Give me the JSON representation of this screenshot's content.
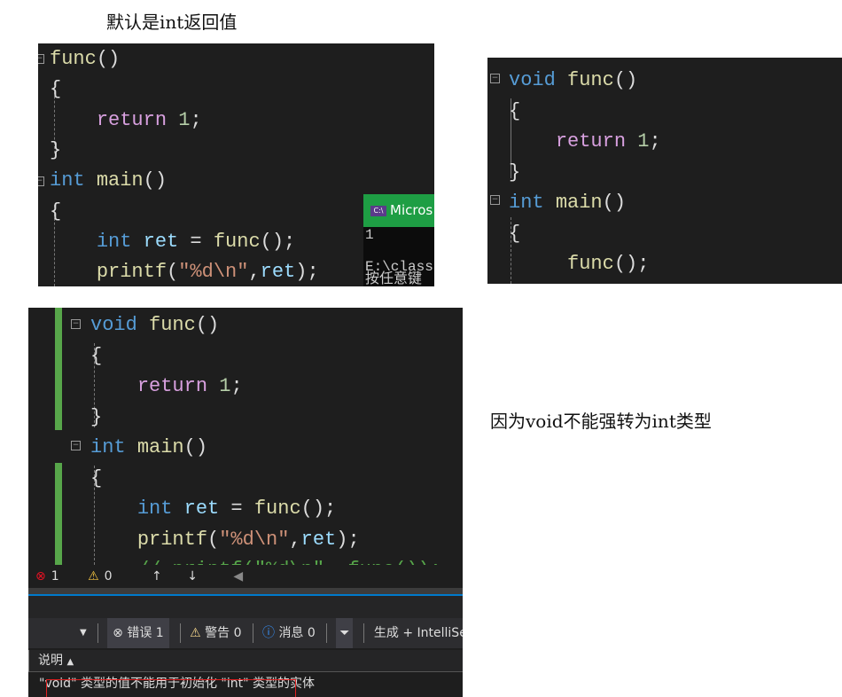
{
  "notes": {
    "top": "默认是int返回值",
    "right": "因为void不能强转为int类型"
  },
  "panel1": {
    "lines": [
      [
        [
          "func",
          "f"
        ],
        [
          "()",
          "p"
        ]
      ],
      [
        [
          "{",
          "p"
        ]
      ],
      [
        [
          "    ",
          "p"
        ],
        [
          "return",
          "c"
        ],
        [
          " ",
          "p"
        ],
        [
          "1",
          "n"
        ],
        [
          ";",
          "p"
        ]
      ],
      [
        [
          "}",
          "p"
        ]
      ],
      [
        [
          "int",
          "k"
        ],
        [
          " ",
          "p"
        ],
        [
          "main",
          "f"
        ],
        [
          "()",
          "p"
        ]
      ],
      [
        [
          "{",
          "p"
        ]
      ],
      [
        [
          "    ",
          "p"
        ],
        [
          "int",
          "k"
        ],
        [
          " ",
          "p"
        ],
        [
          "ret",
          "v"
        ],
        [
          " = ",
          "p"
        ],
        [
          "func",
          "f"
        ],
        [
          "();",
          "p"
        ]
      ],
      [
        [
          "    ",
          "p"
        ],
        [
          "printf",
          "f"
        ],
        [
          "(",
          "p"
        ],
        [
          "\"%d\\n\"",
          "e"
        ],
        [
          ",",
          "p"
        ],
        [
          "ret",
          "v"
        ],
        [
          ");",
          "p"
        ]
      ]
    ],
    "console": {
      "title": "Micros",
      "icon": "C:\\",
      "output": [
        "1",
        "",
        "E:\\class",
        "按任意键"
      ]
    }
  },
  "panel2": {
    "lines": [
      [
        [
          "void",
          "k"
        ],
        [
          " ",
          "p"
        ],
        [
          "func",
          "f"
        ],
        [
          "()",
          "p"
        ]
      ],
      [
        [
          "{",
          "p"
        ]
      ],
      [
        [
          "    ",
          "p"
        ],
        [
          "return",
          "c"
        ],
        [
          " ",
          "p"
        ],
        [
          "1",
          "n"
        ],
        [
          ";",
          "p"
        ]
      ],
      [
        [
          "}",
          "p"
        ]
      ],
      [
        [
          "int",
          "k"
        ],
        [
          " ",
          "p"
        ],
        [
          "main",
          "f"
        ],
        [
          "()",
          "p"
        ]
      ],
      [
        [
          "{",
          "p"
        ]
      ],
      [
        [
          "     ",
          "p"
        ],
        [
          "func",
          "f"
        ],
        [
          "();",
          "p"
        ]
      ]
    ]
  },
  "panel3": {
    "lines": [
      [
        [
          "void",
          "k"
        ],
        [
          " ",
          "p"
        ],
        [
          "func",
          "f"
        ],
        [
          "()",
          "p"
        ]
      ],
      [
        [
          "{",
          "p"
        ]
      ],
      [
        [
          "    ",
          "p"
        ],
        [
          "return",
          "c"
        ],
        [
          " ",
          "p"
        ],
        [
          "1",
          "n"
        ],
        [
          ";",
          "p"
        ]
      ],
      [
        [
          "}",
          "p"
        ]
      ],
      [
        [
          "int",
          "k"
        ],
        [
          " ",
          "p"
        ],
        [
          "main",
          "f"
        ],
        [
          "()",
          "p"
        ]
      ],
      [
        [
          "{",
          "p"
        ]
      ],
      [
        [
          "    ",
          "p"
        ],
        [
          "int",
          "k"
        ],
        [
          " ",
          "p"
        ],
        [
          "ret",
          "v"
        ],
        [
          " = ",
          "p"
        ],
        [
          "func",
          "f"
        ],
        [
          "();",
          "p"
        ]
      ],
      [
        [
          "    ",
          "p"
        ],
        [
          "printf",
          "f"
        ],
        [
          "(",
          "p"
        ],
        [
          "\"%d\\n\"",
          "e"
        ],
        [
          ",",
          "p"
        ],
        [
          "ret",
          "v"
        ],
        [
          ");",
          "p"
        ]
      ],
      [
        [
          "    ",
          "p"
        ],
        [
          "// printf(\"%d\\n\", func());",
          "g"
        ]
      ]
    ],
    "status": {
      "errors": "1",
      "warnings": "0"
    },
    "toolbar": {
      "errors": "错误 1",
      "warnings": "警告 0",
      "messages": "消息 0",
      "build": "生成 + IntelliSense"
    },
    "header": "说明",
    "error_message": "\"void\" 类型的值不能用于初始化 \"int\" 类型的实体"
  },
  "colors": {
    "editor_bg": "#1e1e1e",
    "keyword": "#569cd6",
    "function": "#dcdcaa",
    "control": "#d8a0df",
    "number": "#b5cea8",
    "change_bar": "#57a64a",
    "console_title": "#1e9e44",
    "accent_blue": "#007acc"
  }
}
